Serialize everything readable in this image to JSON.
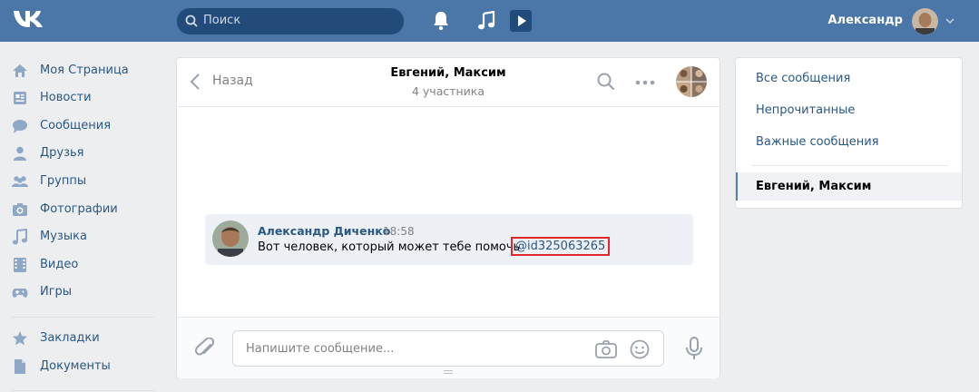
{
  "header": {
    "search_placeholder": "Поиск",
    "user_name": "Александр",
    "icons": [
      "vk-logo-icon",
      "search-icon",
      "bell-icon",
      "music-note-icon",
      "video-play-icon",
      "chevron-down-icon"
    ]
  },
  "nav": {
    "items": [
      {
        "label": "Моя Страница",
        "icon": "home-icon"
      },
      {
        "label": "Новости",
        "icon": "news-icon"
      },
      {
        "label": "Сообщения",
        "icon": "messages-icon"
      },
      {
        "label": "Друзья",
        "icon": "friend-icon"
      },
      {
        "label": "Группы",
        "icon": "groups-icon"
      },
      {
        "label": "Фотографии",
        "icon": "camera-icon"
      },
      {
        "label": "Музыка",
        "icon": "music-icon"
      },
      {
        "label": "Видео",
        "icon": "film-icon"
      },
      {
        "label": "Игры",
        "icon": "gamepad-icon"
      }
    ],
    "extra": [
      {
        "label": "Закладки",
        "icon": "star-icon"
      },
      {
        "label": "Документы",
        "icon": "document-icon"
      }
    ]
  },
  "chat": {
    "back_label": "Назад",
    "title": "Евгений, Максим",
    "subtitle": "4 участника",
    "message": {
      "author": "Александр Диченко",
      "time": "18:58",
      "text": "Вот человек, который может тебе помочь",
      "link": "@id325063265"
    },
    "input_placeholder": "Напишите сообщение..."
  },
  "right_panel": {
    "items": [
      "Все сообщения",
      "Непрочитанные",
      "Важные сообщения"
    ],
    "active": "Евгений, Максим"
  },
  "colors": {
    "header_bg": "#4a76a8",
    "link": "#2a5885",
    "highlight_border": "#e3262b"
  }
}
